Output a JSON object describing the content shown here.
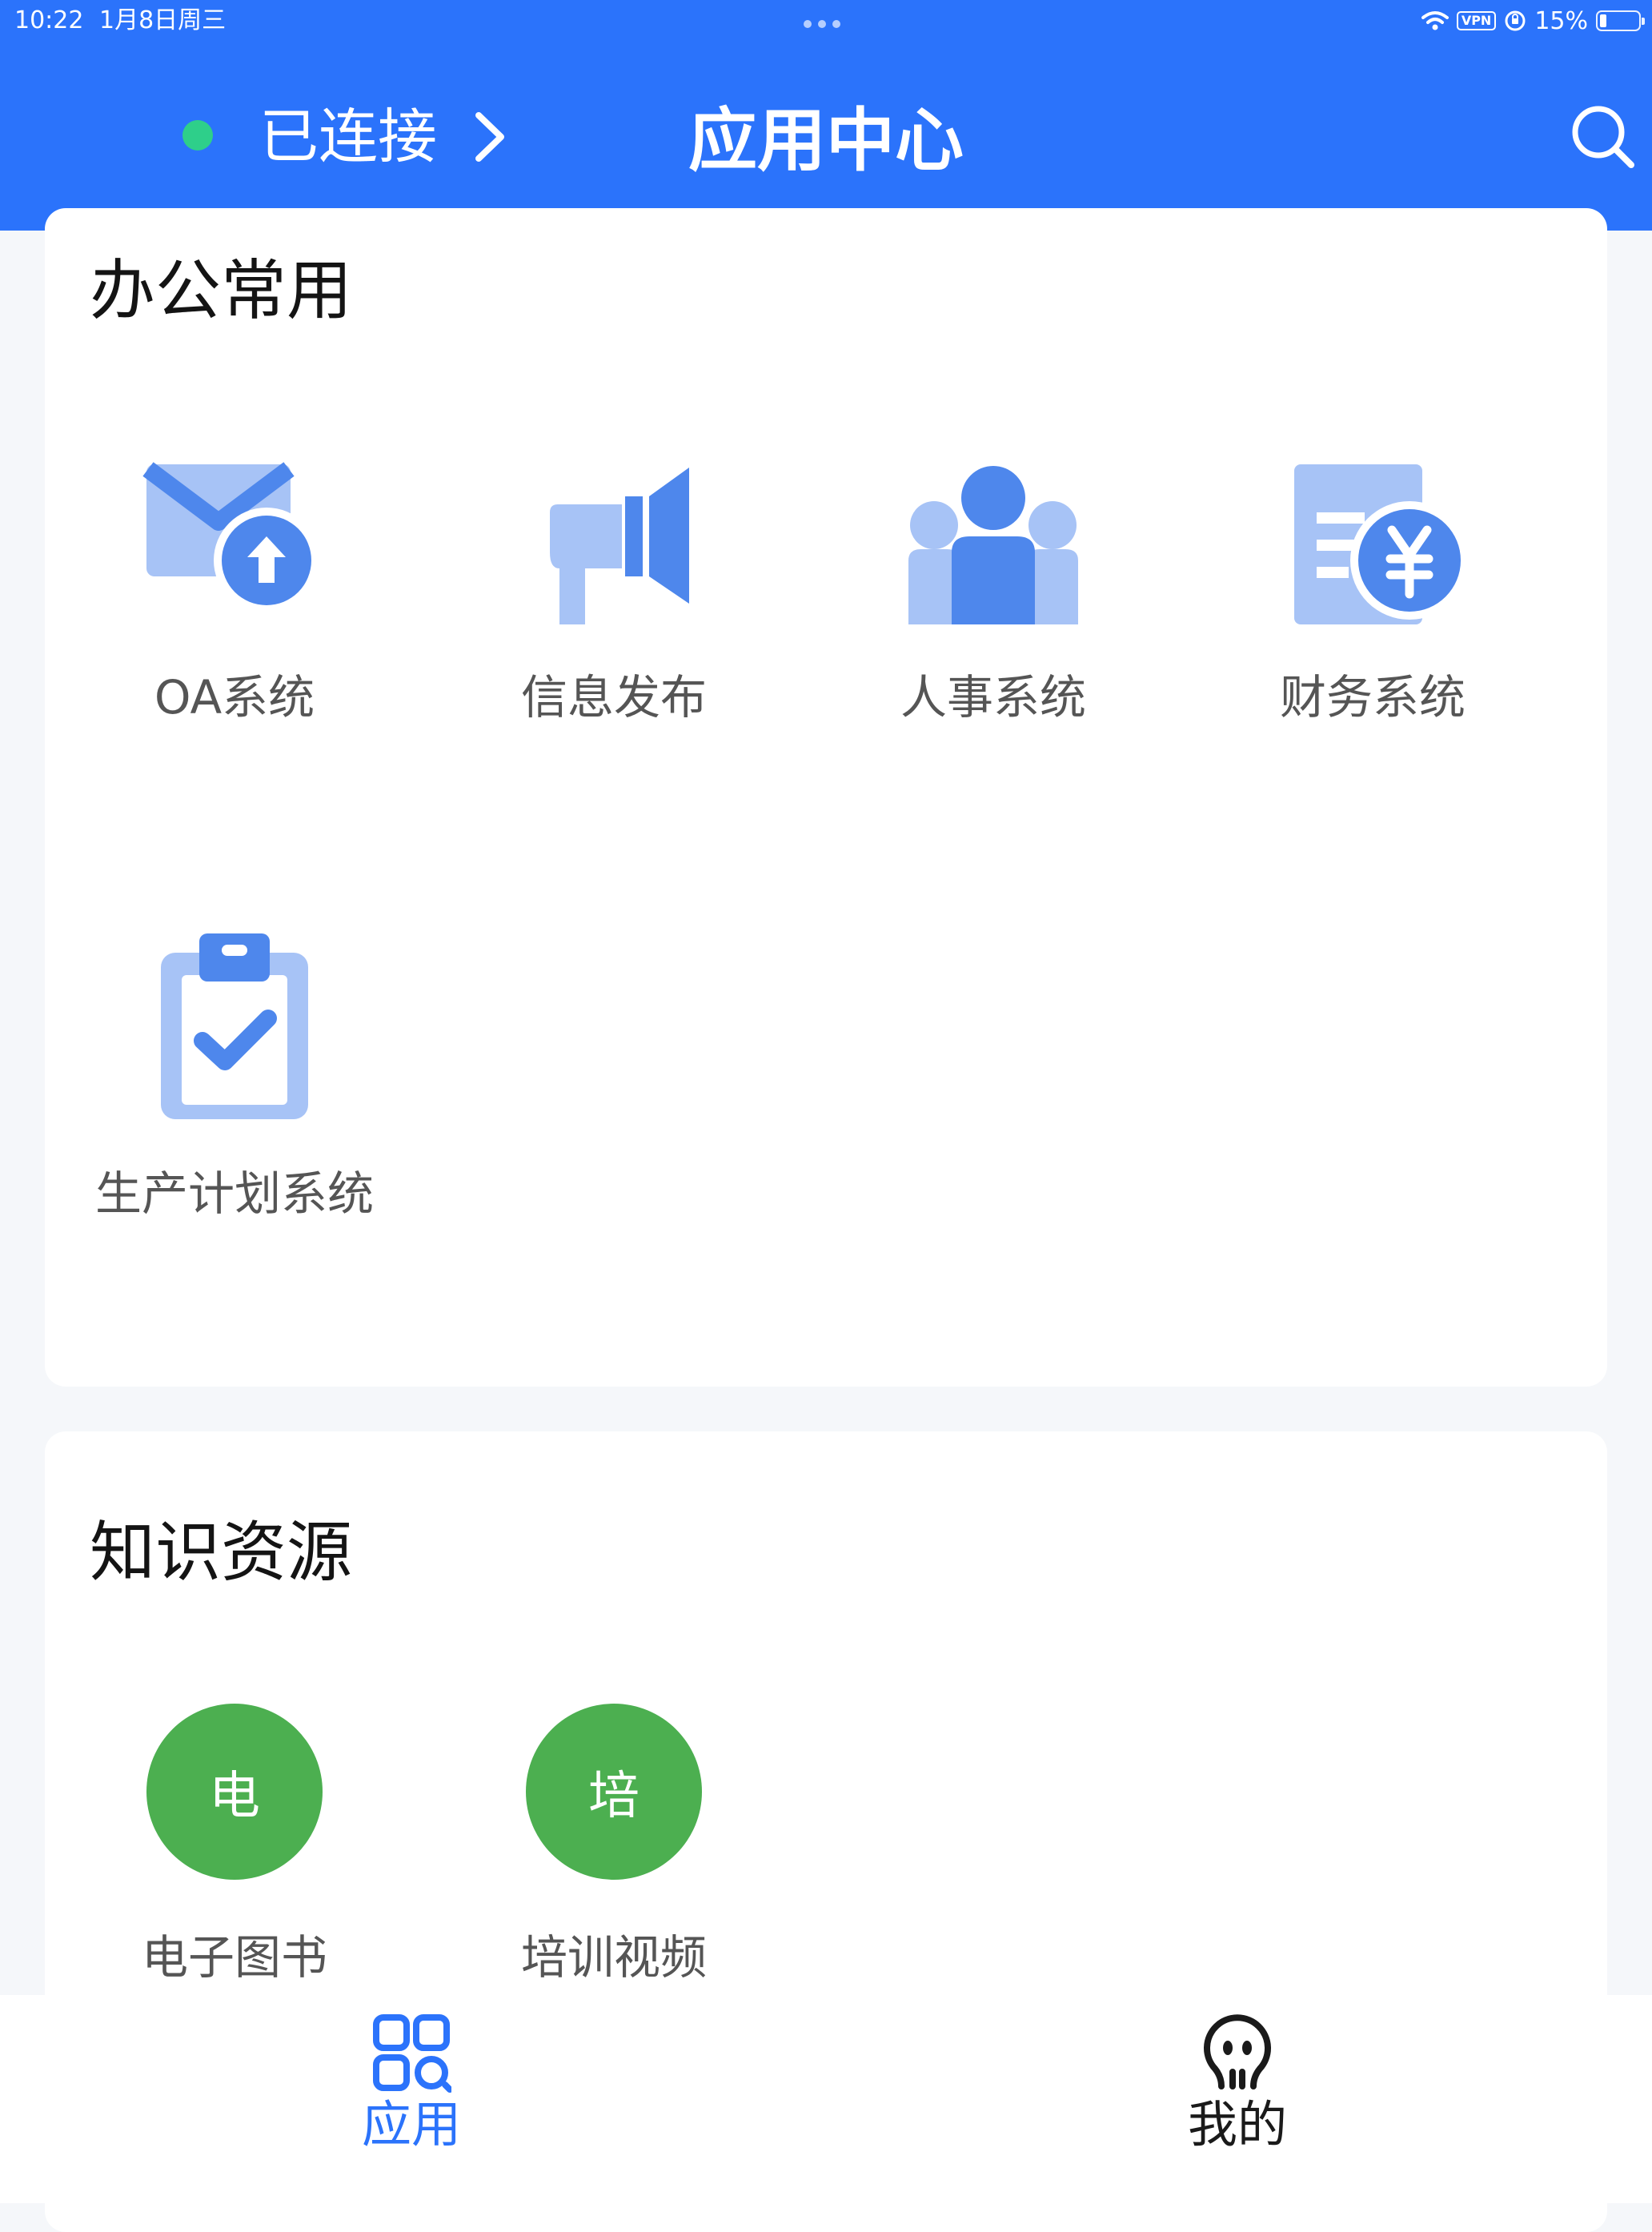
{
  "status_bar": {
    "time": "10:22",
    "date": "1月8日周三",
    "vpn": "VPN",
    "battery": "15%"
  },
  "header": {
    "connection_label": "已连接",
    "title": "应用中心",
    "search_icon": "search-icon"
  },
  "sections": [
    {
      "title": "办公常用",
      "apps": [
        {
          "label": "OA系统",
          "icon": "mail-upload-icon"
        },
        {
          "label": "信息发布",
          "icon": "megaphone-icon"
        },
        {
          "label": "人事系统",
          "icon": "people-icon"
        },
        {
          "label": "财务系统",
          "icon": "finance-yen-icon"
        },
        {
          "label": "生产计划系统",
          "icon": "clipboard-check-icon"
        }
      ]
    },
    {
      "title": "知识资源",
      "apps": [
        {
          "label": "电子图书",
          "letter": "电"
        },
        {
          "label": "培训视频",
          "letter": "培"
        }
      ]
    }
  ],
  "tabs": [
    {
      "label": "应用",
      "icon": "apps-grid-icon",
      "active": true
    },
    {
      "label": "我的",
      "icon": "profile-face-icon",
      "active": false
    }
  ],
  "colors": {
    "primary": "#2b73fb",
    "connected": "#2ecf8a",
    "icon_dark": "#4e87ec",
    "icon_light": "#a7c3f6",
    "green": "#4caf50",
    "tab_active": "#2b73fb",
    "tab_inactive": "#1a1a1a"
  }
}
